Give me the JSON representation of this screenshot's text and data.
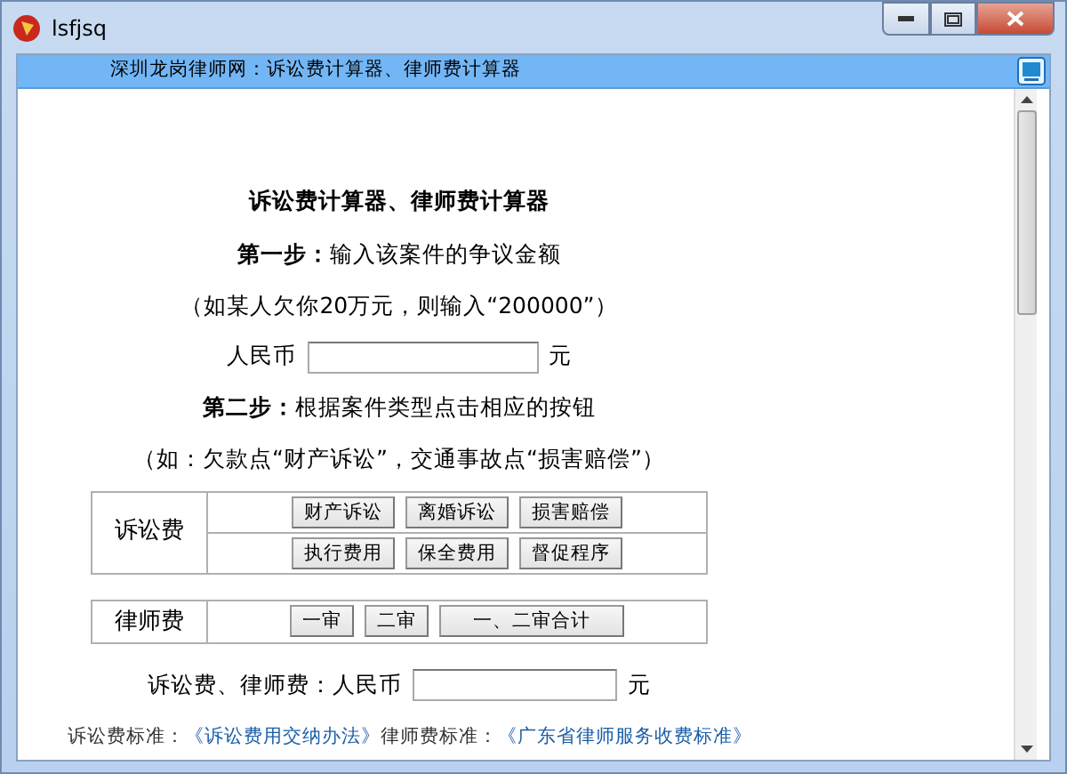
{
  "window": {
    "title": "lsfjsq"
  },
  "header": {
    "title": "深圳龙岗律师网：诉讼费计算器、律师费计算器"
  },
  "page": {
    "heading": "诉讼费计算器、律师费计算器",
    "step1": "**第一步：**输入该案件的争议金额",
    "example1": "（如某人欠你20万元，则输入“200000”）",
    "amount": {
      "label": "人民币",
      "unit": "元"
    },
    "step2": "**第二步：**根据案件类型点击相应的按钮",
    "example2": "（如：欠款点“财产诉讼”，交通事故点“损害赔偿”）",
    "litigation_fees": {
      "label": "诉讼费",
      "rows": [
        [
          "财产诉讼",
          "离婚诉讼",
          "损害赔偿"
        ],
        [
          "执行费用",
          "保全费用",
          "督促程序"
        ]
      ]
    },
    "lawyer_fees": {
      "label": "律师费",
      "buttons": [
        "一审",
        "二审",
        "一、二审合计"
      ]
    },
    "result": {
      "label": "诉讼费、律师费：人民币",
      "unit": "元"
    },
    "footer": [
      {
        "kind": "text",
        "text": "诉讼费标准："
      },
      {
        "kind": "link",
        "text": "《诉讼费用交纳办法》"
      },
      {
        "kind": "text",
        "text": "律师费标准："
      },
      {
        "kind": "link",
        "text": "《广东省律师服务收费标准》"
      }
    ]
  }
}
